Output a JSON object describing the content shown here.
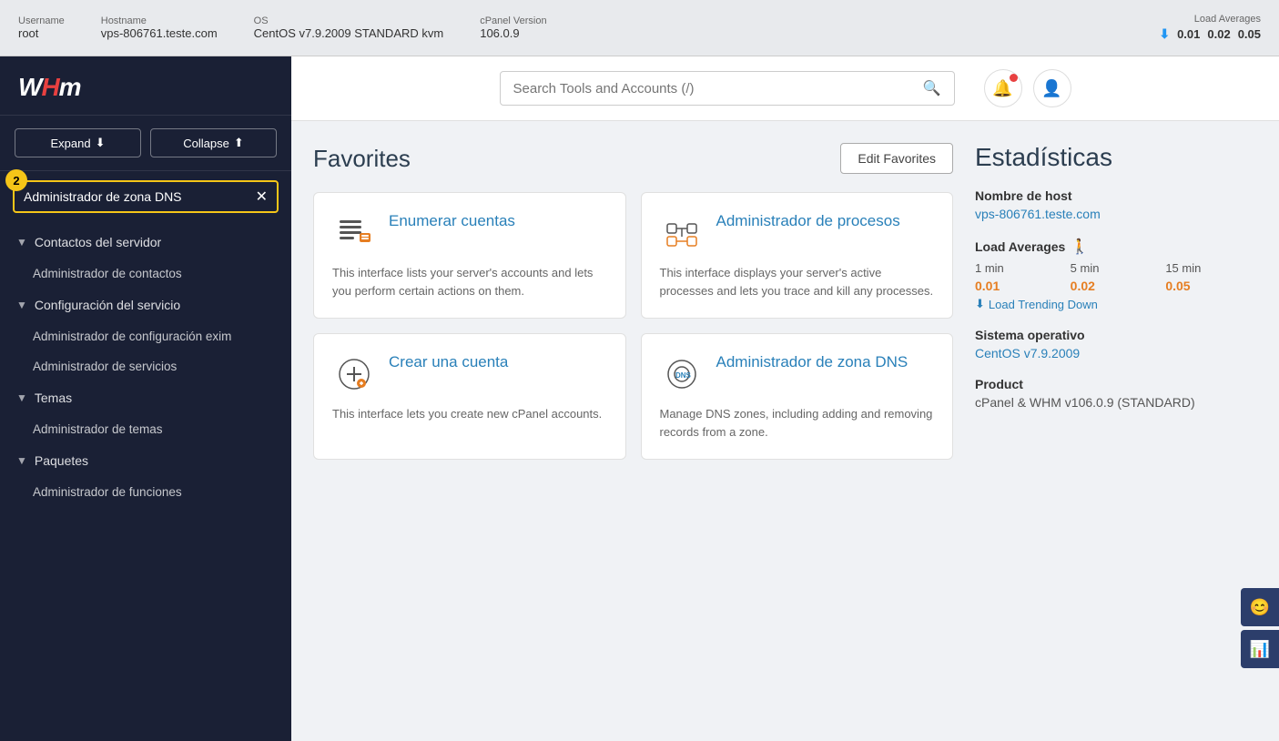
{
  "topbar": {
    "username_label": "Username",
    "username_value": "root",
    "hostname_label": "Hostname",
    "hostname_value": "vps-806761.teste.com",
    "os_label": "OS",
    "os_value": "CentOS v7.9.2009 STANDARD kvm",
    "cpanel_label": "cPanel Version",
    "cpanel_value": "106.0.9",
    "load_label": "Load Averages",
    "load_1": "0.01",
    "load_5": "0.02",
    "load_15": "0.05"
  },
  "sidebar": {
    "logo": "WHm",
    "expand_btn": "Expand",
    "collapse_btn": "Collapse",
    "search_placeholder": "Administrador de zona DNS",
    "search_badge": "2",
    "nav_groups": [
      {
        "label": "Contactos del servidor",
        "expanded": true,
        "items": [
          "Administrador de contactos"
        ]
      },
      {
        "label": "Configuración del servicio",
        "expanded": true,
        "items": [
          "Administrador de configuración exim",
          "Administrador de servicios"
        ]
      },
      {
        "label": "Temas",
        "expanded": true,
        "items": [
          "Administrador de temas"
        ]
      },
      {
        "label": "Paquetes",
        "expanded": true,
        "items": [
          "Administrador de funciones"
        ]
      }
    ]
  },
  "header": {
    "search_placeholder": "Search Tools and Accounts (/)"
  },
  "favorites": {
    "title": "Favorites",
    "edit_btn": "Edit Favorites",
    "cards": [
      {
        "title": "Enumerar cuentas",
        "desc": "This interface lists your server's accounts and lets you perform certain actions on them.",
        "icon": "list"
      },
      {
        "title": "Administrador de procesos",
        "desc": "This interface displays your server's active processes and lets you trace and kill any processes.",
        "icon": "process"
      },
      {
        "title": "Crear una cuenta",
        "desc": "This interface lets you create new cPanel accounts.",
        "icon": "add"
      },
      {
        "title": "Administrador de zona DNS",
        "desc": "Manage DNS zones, including adding and removing records from a zone.",
        "icon": "dns"
      }
    ]
  },
  "stats": {
    "title": "Estadísticas",
    "hostname_label": "Nombre de host",
    "hostname_value": "vps-806761.teste.com",
    "load_label": "Load Averages",
    "load_1min_label": "1 min",
    "load_5min_label": "5 min",
    "load_15min_label": "15 min",
    "load_1min_value": "0.01",
    "load_5min_value": "0.02",
    "load_15min_value": "0.05",
    "load_trending": "Load Trending Down",
    "os_label": "Sistema operativo",
    "os_value": "CentOS v7.9.2009",
    "product_label": "Product",
    "product_value": "cPanel & WHM v106.0.9 (STANDARD)"
  }
}
